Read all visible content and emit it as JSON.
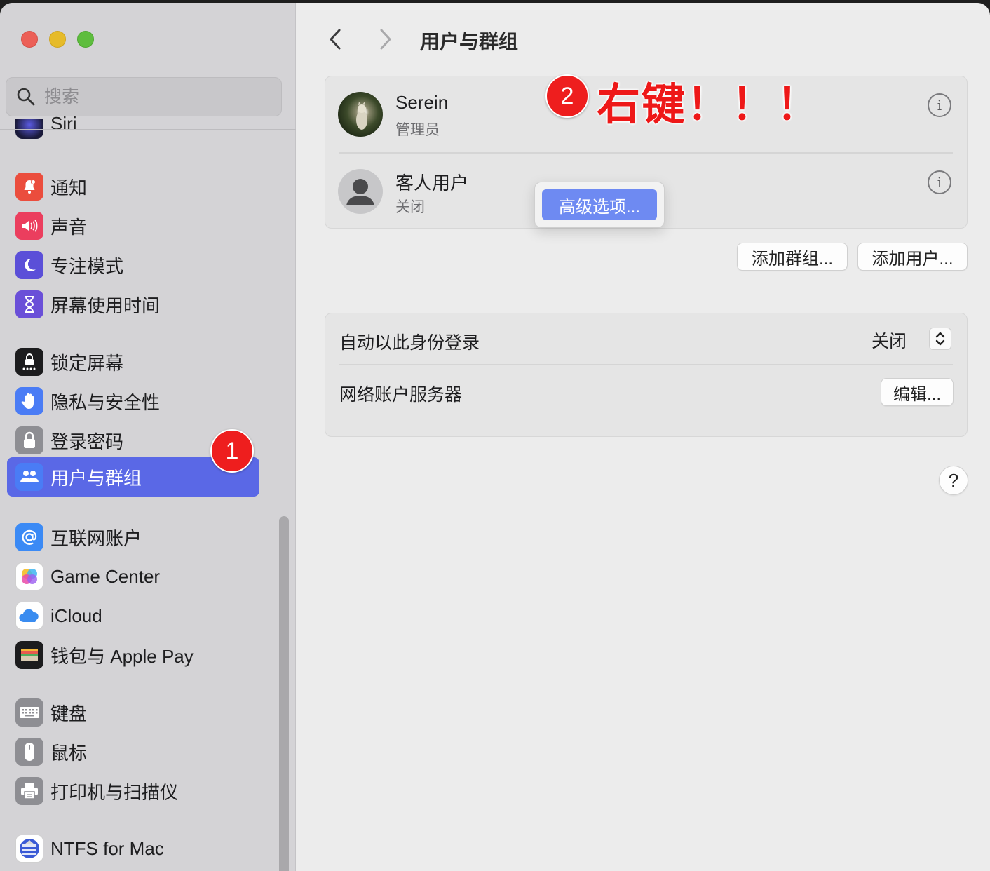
{
  "search": {
    "placeholder": "搜索"
  },
  "sidebar": {
    "partial_item": "Siri",
    "items": [
      {
        "id": "notifications",
        "label": "通知",
        "icon": "bell-icon",
        "color": "#eb4d3d"
      },
      {
        "id": "sound",
        "label": "声音",
        "icon": "speaker-icon",
        "color": "#eb3e5e"
      },
      {
        "id": "focus",
        "label": "专注模式",
        "icon": "moon-icon",
        "color": "#5b4fd8"
      },
      {
        "id": "screen-time",
        "label": "屏幕使用时间",
        "icon": "hourglass-icon",
        "color": "#6a4fd8"
      },
      {
        "id": "lock-screen",
        "label": "锁定屏幕",
        "icon": "lock-screen-icon",
        "color": "#1c1c1e"
      },
      {
        "id": "privacy",
        "label": "隐私与安全性",
        "icon": "hand-icon",
        "color": "#4a7cf5"
      },
      {
        "id": "login-password",
        "label": "登录密码",
        "icon": "padlock-icon",
        "color": "#8e8e93"
      },
      {
        "id": "users-groups",
        "label": "用户与群组",
        "icon": "users-icon",
        "color": "#4a7cf5"
      },
      {
        "id": "internet-accounts",
        "label": "互联网账户",
        "icon": "at-sign-icon",
        "color": "#3b8af5"
      },
      {
        "id": "game-center",
        "label": "Game Center",
        "icon": "game-center-icon",
        "color": "#ffffff"
      },
      {
        "id": "icloud",
        "label": "iCloud",
        "icon": "cloud-icon",
        "color": "#ffffff"
      },
      {
        "id": "wallet",
        "label": "钱包与 Apple Pay",
        "icon": "wallet-icon",
        "color": "#1c1c1e"
      },
      {
        "id": "keyboard",
        "label": "键盘",
        "icon": "keyboard-icon",
        "color": "#8e8e93"
      },
      {
        "id": "mouse",
        "label": "鼠标",
        "icon": "mouse-icon",
        "color": "#8e8e93"
      },
      {
        "id": "printers",
        "label": "打印机与扫描仪",
        "icon": "printer-icon",
        "color": "#8e8e93"
      },
      {
        "id": "ntfs",
        "label": "NTFS for Mac",
        "icon": "ntfs-icon",
        "color": "#3a5ad6"
      }
    ]
  },
  "annotations": {
    "badge1": "1",
    "badge2": "2",
    "callout": "右键！！！"
  },
  "main": {
    "title": "用户与群组",
    "users": [
      {
        "name": "Serein",
        "role": "管理员"
      },
      {
        "name": "客人用户",
        "role": "关闭"
      }
    ],
    "context_menu": {
      "item": "高级选项..."
    },
    "buttons": {
      "add_group": "添加群组...",
      "add_user": "添加用户..."
    },
    "settings": {
      "auto_login_label": "自动以此身份登录",
      "auto_login_value": "关闭",
      "network_server_label": "网络账户服务器",
      "edit_button": "编辑..."
    },
    "help": "?"
  }
}
